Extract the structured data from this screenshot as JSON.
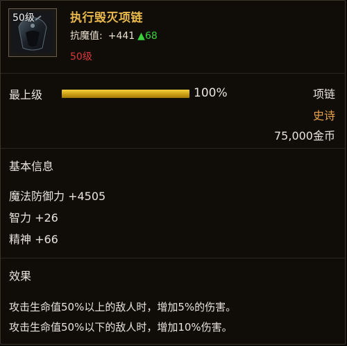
{
  "item": {
    "level_badge": "50级",
    "name": "执行毁灭项链",
    "magic_resist_label": "抗魔值:",
    "magic_resist_value": "+441",
    "magic_resist_up_icon": "▲",
    "magic_resist_increase": "68",
    "required_level": "50级",
    "max_level_label": "最上级",
    "upgrade_progress": 1.0,
    "upgrade_percent_text": "100%",
    "type": "项链",
    "rarity": "史诗",
    "price": "75,000金币"
  },
  "basic_info": {
    "title": "基本信息",
    "stats": [
      "魔法防御力 +4505",
      "智力 +26",
      "精神 +66"
    ]
  },
  "effects": {
    "title": "效果",
    "lines": [
      "攻击生命值50%以上的敌人时，增加5%的伤害。",
      "攻击生命值50%以下的敌人时，增加10%伤害。"
    ]
  },
  "colors": {
    "item_name": "#e8b84a",
    "rarity": "#e8a24a",
    "required_level": "#d83a3a",
    "increase": "#39d23b",
    "bar_fill": "#f0c83a"
  }
}
